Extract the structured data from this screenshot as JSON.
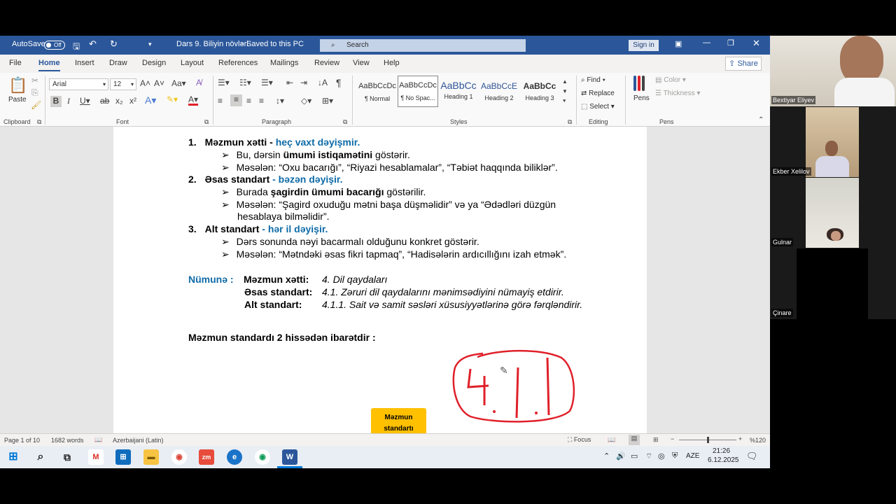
{
  "titlebar": {
    "autosave_label": "AutoSave",
    "autosave_state": "Off",
    "doc_title": "Dars 9. Biliyin növləri",
    "save_status": "Saved to this PC",
    "search_placeholder": "Search",
    "signin_label": "Sign in"
  },
  "menu": {
    "items": [
      "File",
      "Home",
      "Insert",
      "Draw",
      "Design",
      "Layout",
      "References",
      "Mailings",
      "Review",
      "View",
      "Help"
    ],
    "share_label": "Share"
  },
  "ribbon": {
    "clipboard": {
      "paste_label": "Paste",
      "group_label": "Clipboard"
    },
    "font": {
      "font_name": "Arial",
      "font_size": "12",
      "group_label": "Font"
    },
    "paragraph": {
      "group_label": "Paragraph"
    },
    "styles": {
      "group_label": "Styles",
      "items": [
        {
          "sample": "AaBbCcDc",
          "name": "¶ Normal"
        },
        {
          "sample": "AaBbCcDc",
          "name": "¶ No Spac..."
        },
        {
          "sample": "AaBbCc",
          "name": "Heading 1"
        },
        {
          "sample": "AaBbCcE",
          "name": "Heading 2"
        },
        {
          "sample": "AaBbCc",
          "name": "Heading 3"
        }
      ]
    },
    "editing": {
      "find": "Find",
      "replace": "Replace",
      "select": "Select",
      "group_label": "Editing"
    },
    "pens": {
      "pens_label": "Pens",
      "color": "Color",
      "thickness": "Thickness",
      "group_label": "Pens"
    }
  },
  "document": {
    "l1_num": "1.",
    "l1_bold": "Məzmun xətti - ",
    "l1_blue": "heç vaxt dəyişmir.",
    "l2_pre": "Bu, dərsin ",
    "l2_bold": "ümumi istiqamətini",
    "l2_post": " göstərir.",
    "l3": "Məsələn: “Oxu bacarığı”, “Riyazi hesablamalar”, “Təbiət haqqında biliklər”.",
    "l4_num": "2.",
    "l4_bold": "Əsas standart",
    "l4_blue": " - bəzən dəyişir.",
    "l5_pre": "Burada ",
    "l5_bold": "şagirdin ümumi bacarığı",
    "l5_post": " göstərilir.",
    "l6": "Məsələn: “Şagird oxuduğu mətni başa düşməlidir” və ya “Ədədləri düzgün",
    "l6b": "hesablaya bilməlidir”.",
    "l7_num": "3.",
    "l7_bold": "Alt standart",
    "l7_blue": " - hər il dəyişir.",
    "l8": "Dərs sonunda nəyi bacarmalı olduğunu konkret göstərir.",
    "l9": "Məsələn: “Mətndəki əsas fikri tapmaq”, “Hadisələrin ardıcıllığını izah etmək”.",
    "example_label": "Nümunə :",
    "ex1_label": "Məzmun xətti:",
    "ex1_value": "4. Dil qaydaları",
    "ex2_label": "Əsas standart:",
    "ex2_value": "4.1. Zəruri dil qaydalarını mənimsədiyini nümayiş etdirir.",
    "ex3_label": "Alt standart:",
    "ex3_value": "4.1.1. Sait və samit səsləri xüsusiyyətlərinə görə fərqləndirir.",
    "section": "Məzmun standardı 2 hissədən ibarətdir :",
    "box_label_1": "Məzmun",
    "box_label_2": "standartı",
    "handwriting_color": "#e0202a",
    "box_color": "#ffc000",
    "arrow_left_color": "#5b9bd5",
    "arrow_right_color": "#ffc000"
  },
  "status": {
    "page": "Page 1 of 10",
    "words": "1682 words",
    "language": "Azerbaijani (Latin)",
    "focus": "Focus",
    "zoom": "%120"
  },
  "taskbar": {
    "lang": "AZE",
    "time": "21:26",
    "date": "6.12.2025"
  },
  "participants": [
    {
      "name": "Bextiyar Eliyev"
    },
    {
      "name": "Ekber Xelilov"
    },
    {
      "name": "Gulnar"
    },
    {
      "name": "Çinare"
    }
  ]
}
